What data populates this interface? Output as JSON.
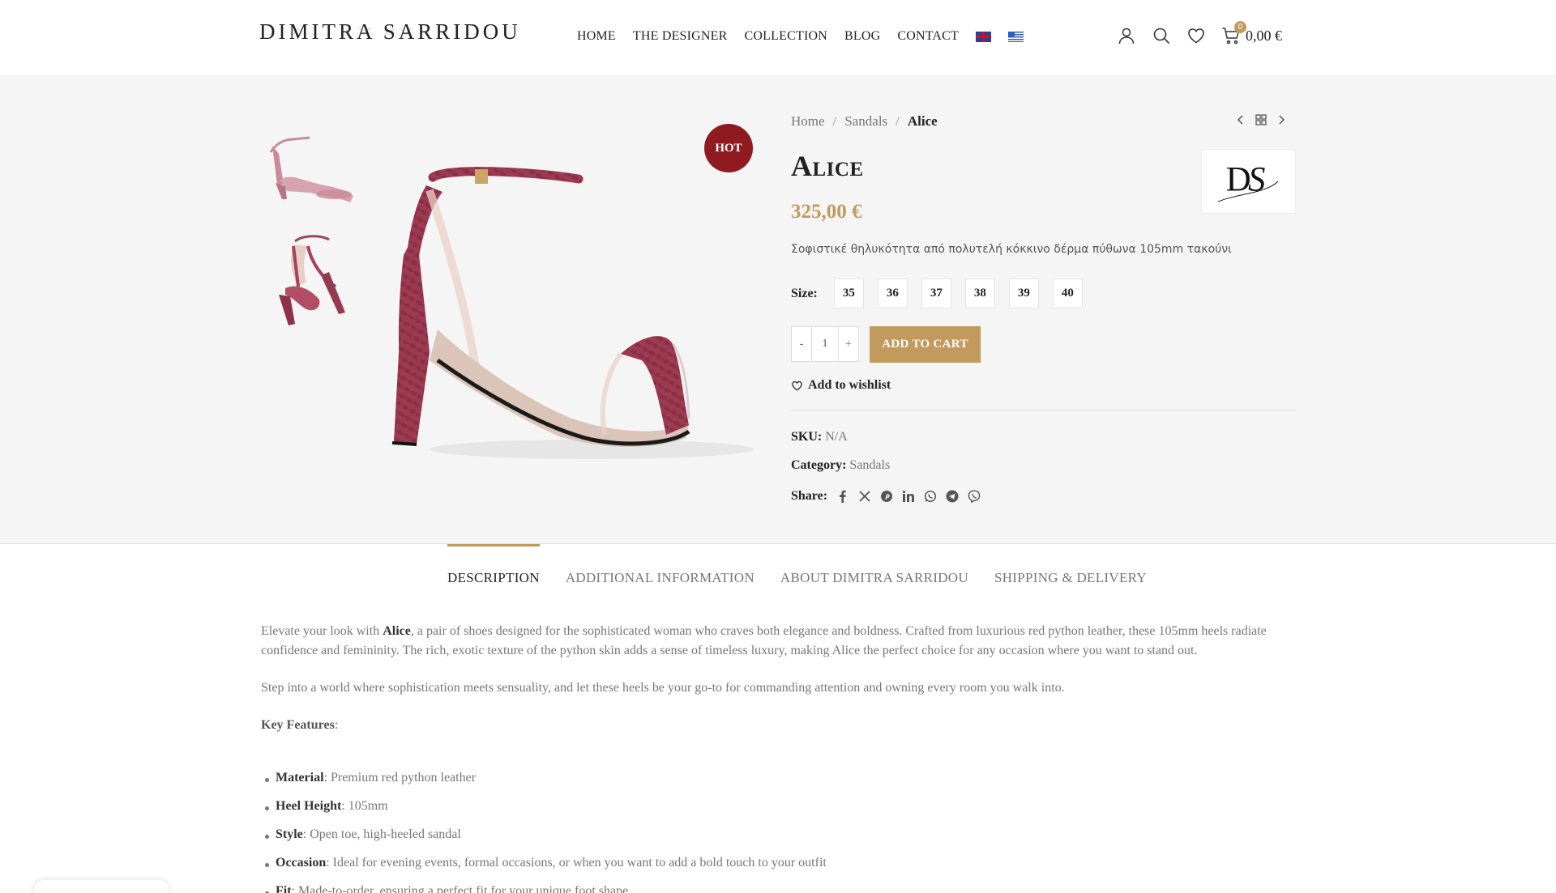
{
  "header": {
    "logo_text": "DIMITRA SARRIDOU",
    "nav": [
      "HOME",
      "THE DESIGNER",
      "COLLECTION",
      "BLOG",
      "CONTACT"
    ],
    "flags": [
      "uk-flag-icon",
      "greek-flag-icon"
    ],
    "cart_count": "0",
    "cart_total": "0,00 €"
  },
  "product": {
    "badge": "HOT",
    "breadcrumb": {
      "home": "Home",
      "category": "Sandals",
      "current": "Alice"
    },
    "title": "Alice",
    "price": "325,00 €",
    "short_description": "Σοφιστικέ θηλυκότητα από πολυτελή κόκκινο δέρμα πύθωνα 105mm τακούνι",
    "size_label": "Size",
    "sizes": [
      "35",
      "36",
      "37",
      "38",
      "39",
      "40"
    ],
    "quantity": "1",
    "qty_minus": "-",
    "qty_plus": "+",
    "add_to_cart": "ADD TO CART",
    "wishlist": "Add to wishlist",
    "sku_label": "SKU:",
    "sku_value": "N/A",
    "category_label": "Category:",
    "category_value": "Sandals",
    "share_label": "Share:"
  },
  "tabs": [
    "DESCRIPTION",
    "ADDITIONAL INFORMATION",
    "ABOUT DIMITRA SARRIDOU",
    "SHIPPING & DELIVERY"
  ],
  "description": {
    "p1_pre": "Elevate your look with ",
    "p1_bold": "Alice",
    "p1_post": ", a pair of shoes designed for the sophisticated woman who craves both elegance and boldness. Crafted from luxurious red python leather, these 105mm heels radiate confidence and femininity. The rich, exotic texture of the python skin adds a sense of timeless luxury, making Alice the perfect choice for any occasion where you want to stand out.",
    "p2": "Step into a world where sophistication meets sensuality, and let these heels be your go-to for commanding attention and owning every room you walk into.",
    "key_features": "Key Features",
    "features": [
      {
        "label": "Material",
        "value": ": Premium red python leather"
      },
      {
        "label": "Heel Height",
        "value": ": 105mm"
      },
      {
        "label": "Style",
        "value": ": Open toe, high-heeled sandal"
      },
      {
        "label": "Occasion",
        "value": ": Ideal for evening events, formal occasions, or when you want to add a bold touch to your outfit"
      },
      {
        "label": "Fit",
        "value": ": Made-to-order, ensuring a perfect fit for your unique foot shape"
      }
    ]
  },
  "colors": {
    "accent": "#c29a5c",
    "hot_badge": "#8f1a1f",
    "shoe": "#9b3a50"
  }
}
